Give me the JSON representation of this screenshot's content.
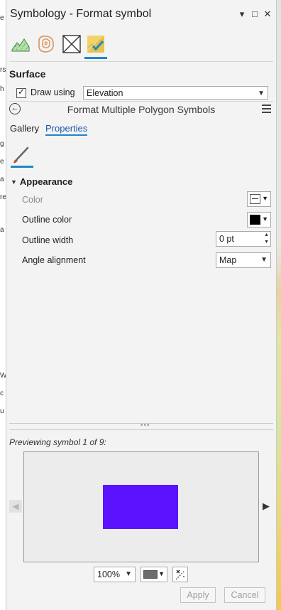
{
  "window": {
    "title": "Symbology - Format symbol",
    "controls": {
      "options": "▾",
      "maximize": "□",
      "close": "✕"
    }
  },
  "symbol_tabs": [
    {
      "name": "surface-tab",
      "icon": "terrain-icon"
    },
    {
      "name": "contour-tab",
      "icon": "contour-icon"
    },
    {
      "name": "vector-tab",
      "icon": "no-symbol-icon"
    },
    {
      "name": "format-tab",
      "icon": "symbol-format-icon",
      "active": true
    }
  ],
  "surface": {
    "heading": "Surface",
    "draw_using_label": "Draw using",
    "draw_using_checked": true,
    "draw_using_value": "Elevation"
  },
  "format": {
    "title": "Format Multiple Polygon Symbols",
    "tabs": {
      "gallery": "Gallery",
      "properties": "Properties"
    },
    "active_tab": "Properties"
  },
  "appearance": {
    "heading": "Appearance",
    "color_label": "Color",
    "outline_color_label": "Outline color",
    "outline_color": "#000000",
    "outline_width_label": "Outline width",
    "outline_width_value": "0 pt",
    "angle_alignment_label": "Angle alignment",
    "angle_alignment_value": "Map"
  },
  "preview": {
    "label": "Previewing symbol 1 of 9:",
    "fill_color": "#5b12ff",
    "zoom": "100%",
    "background_swatch": "#6b6b6b"
  },
  "buttons": {
    "apply": "Apply",
    "cancel": "Cancel"
  },
  "background_text": [
    "e",
    "rs",
    "h",
    "g",
    "e",
    "a",
    "re",
    "a",
    "W",
    "c",
    "u"
  ]
}
